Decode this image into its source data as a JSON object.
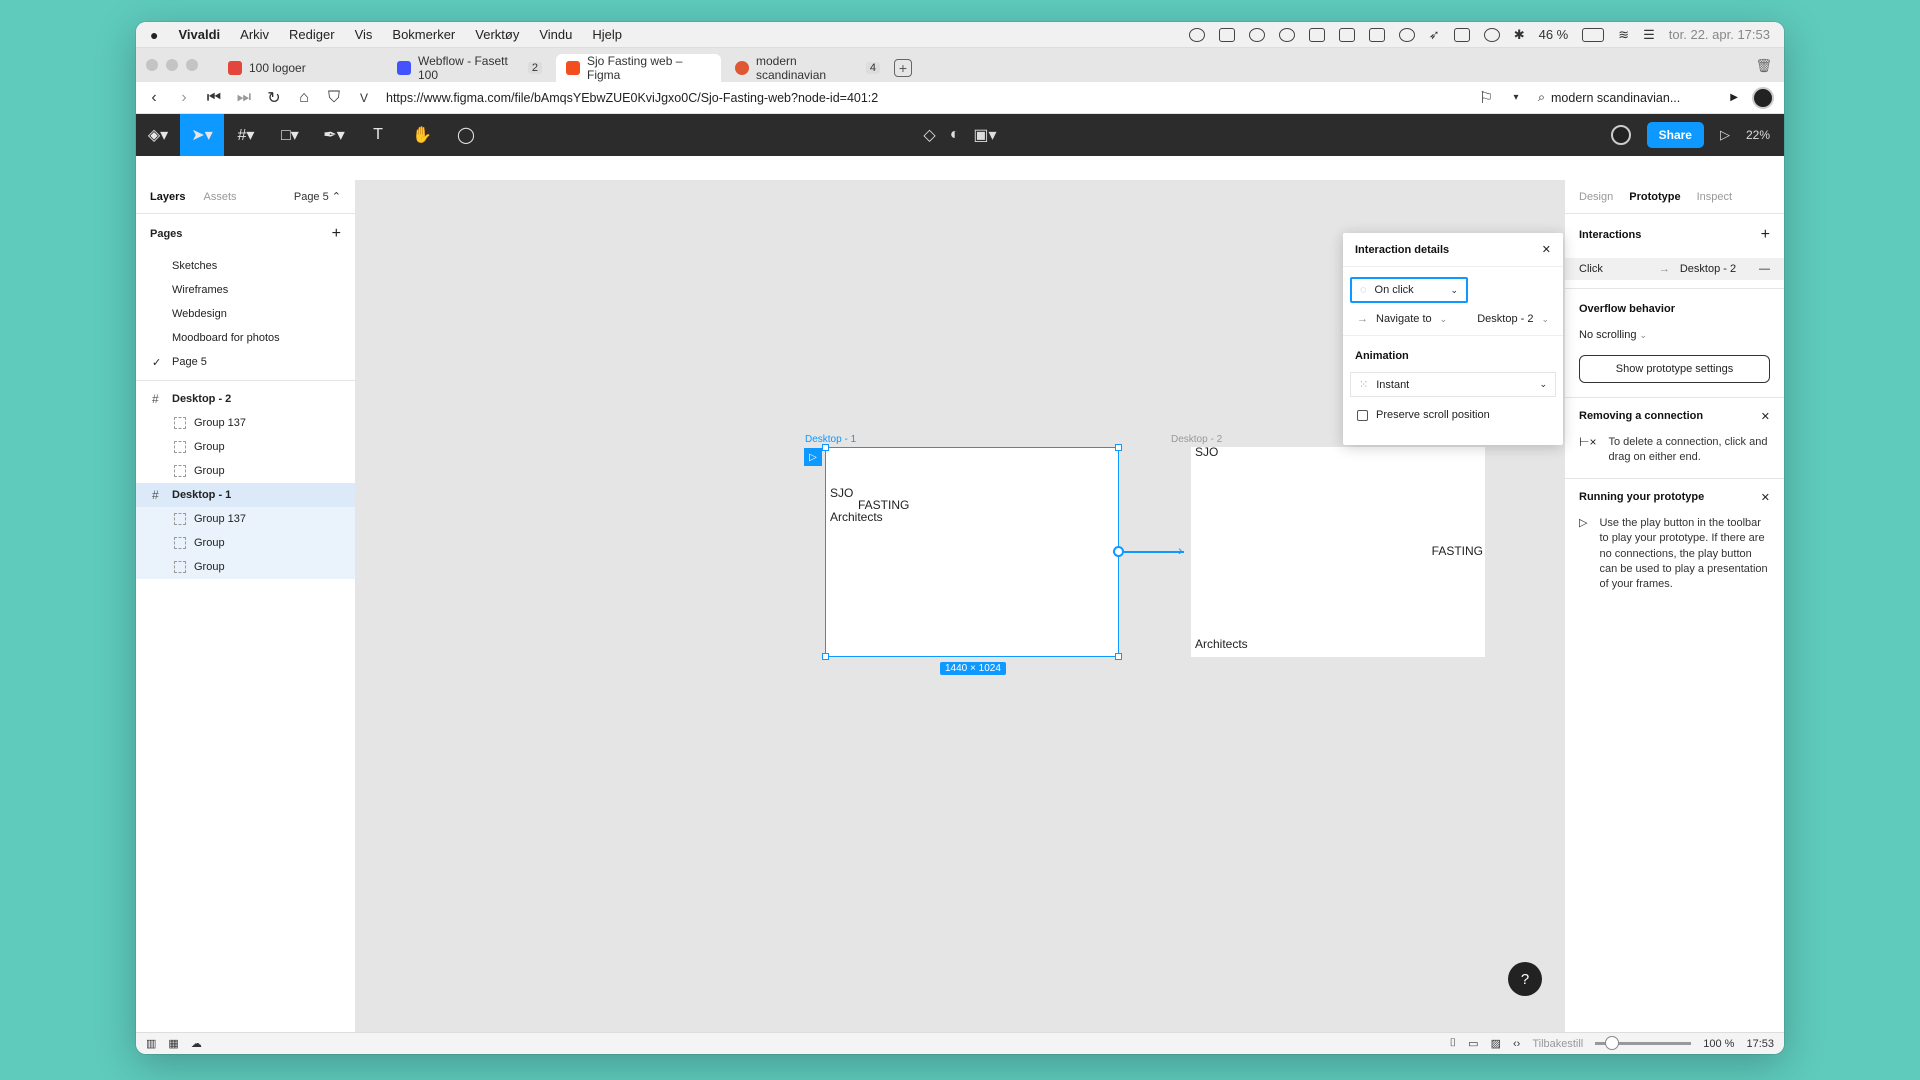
{
  "menubar": {
    "apple": "",
    "app": "Vivaldi",
    "items": [
      "Arkiv",
      "Rediger",
      "Vis",
      "Bokmerker",
      "Verktøy",
      "Vindu",
      "Hjelp"
    ],
    "battery": "46 %",
    "datetime": "tor. 22. apr.  17:53"
  },
  "tabs": [
    {
      "label": "100 logoer",
      "count": "",
      "color": "#e2463c"
    },
    {
      "label": "Webflow - Fasett 100",
      "count": "2",
      "color": "#4353ff"
    },
    {
      "label": "Sjo Fasting web – Figma",
      "count": "",
      "color": "#f24e1e"
    },
    {
      "label": "modern scandinavian",
      "count": "4",
      "color": "#de5833"
    }
  ],
  "address": {
    "url": "https://www.figma.com/file/bAmqsYEbwZUE0KviJgxo0C/Sjo-Fasting-web?node-id=401:2",
    "search": "modern scandinavian..."
  },
  "figma_toolbar": {
    "share": "Share",
    "zoom": "22%"
  },
  "left_panel": {
    "tab_layers": "Layers",
    "tab_assets": "Assets",
    "page_selector": "Page 5 ⌃",
    "pages_title": "Pages",
    "pages": [
      "Sketches",
      "Wireframes",
      "Webdesign",
      "Moodboard for photos",
      "Page 5"
    ],
    "layers": [
      {
        "label": "Desktop - 2",
        "type": "frame"
      },
      {
        "label": "Group 137",
        "type": "child"
      },
      {
        "label": "Group",
        "type": "child"
      },
      {
        "label": "Group",
        "type": "child"
      },
      {
        "label": "Desktop - 1",
        "type": "frame"
      },
      {
        "label": "Group 137",
        "type": "child"
      },
      {
        "label": "Group",
        "type": "child"
      },
      {
        "label": "Group",
        "type": "child"
      }
    ]
  },
  "canvas": {
    "frame1_label": "Desktop - 1",
    "frame2_label": "Desktop - 2",
    "f1_sjo": "SJO",
    "f1_fasting": "FASTING",
    "f1_arch": "Architects",
    "f2_sjo": "SJO",
    "f2_fasting": "FASTING",
    "f2_arch": "Architects",
    "dimensions": "1440 × 1024"
  },
  "interaction_popup": {
    "title": "Interaction details",
    "trigger": "On click",
    "action": "Navigate to",
    "destination": "Desktop - 2",
    "animation_title": "Animation",
    "animation": "Instant",
    "preserve_scroll": "Preserve scroll position"
  },
  "right_panel": {
    "tabs": [
      "Design",
      "Prototype",
      "Inspect"
    ],
    "interactions_title": "Interactions",
    "interaction_trigger": "Click",
    "interaction_dest": "Desktop - 2",
    "overflow_title": "Overflow behavior",
    "overflow_value": "No scrolling",
    "show_settings": "Show prototype settings",
    "removing_title": "Removing a connection",
    "removing_text": "To delete a connection, click and drag on either end.",
    "running_title": "Running your prototype",
    "running_text": "Use the play button in the toolbar to play your prototype. If there are no connections, the play button can be used to play a presentation of your frames."
  },
  "statusbar": {
    "reset": "Tilbakestill",
    "zoom": "100 %",
    "time": "17:53"
  }
}
